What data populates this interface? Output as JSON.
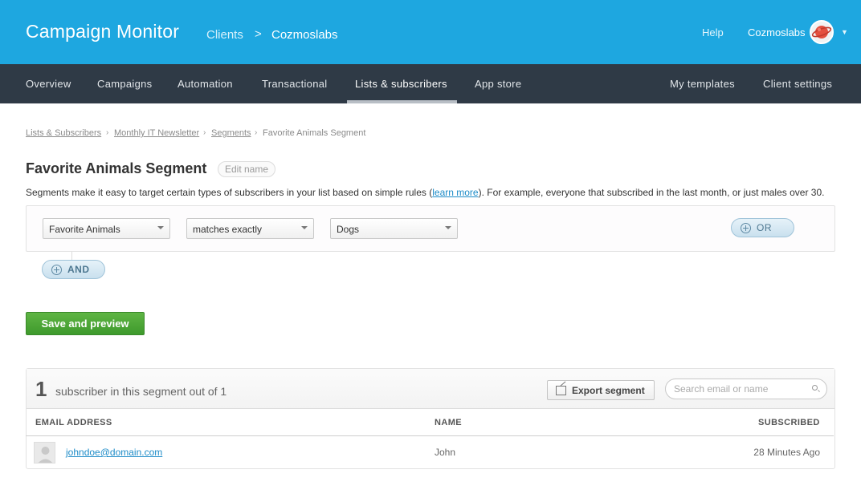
{
  "header": {
    "brand": "Campaign Monitor",
    "breadcrumb_clients": "Clients",
    "breadcrumb_separator": ">",
    "client_name": "Cozmoslabs",
    "help": "Help",
    "user_name": "Cozmoslabs",
    "avatar_icon": "planet-icon",
    "caret_icon": "caret-down-icon",
    "colors": {
      "header_bg": "#1ea7e0",
      "nav_bg": "#2f3a46"
    }
  },
  "nav": {
    "items": [
      {
        "label": "Overview"
      },
      {
        "label": "Campaigns"
      },
      {
        "label": "Automation"
      },
      {
        "label": "Transactional"
      },
      {
        "label": "Lists & subscribers",
        "active": true
      },
      {
        "label": "App store"
      }
    ],
    "right_items": [
      {
        "label": "My templates"
      },
      {
        "label": "Client settings"
      }
    ]
  },
  "breadcrumb": {
    "items": [
      "Lists & Subscribers",
      "Monthly IT Newsletter",
      "Segments",
      "Favorite Animals Segment"
    ],
    "separator": "›"
  },
  "segment": {
    "title": "Favorite Animals Segment",
    "edit_name": "Edit name",
    "description_before": "Segments make it easy to target certain types of subscribers in your list based on simple rules (",
    "description_link": "learn more",
    "description_after": "). For example, everyone that subscribed in the last month, or just males over 30."
  },
  "rule": {
    "field": "Favorite Animals",
    "operator": "matches exactly",
    "value": "Dogs",
    "or_label": "OR",
    "and_label": "AND"
  },
  "actions": {
    "save_preview": "Save and preview",
    "save_color": "#4aa735"
  },
  "results": {
    "count": "1",
    "count_text": "subscriber in this segment out of 1",
    "export_label": "Export segment",
    "search_placeholder": "Search email or name",
    "columns": [
      "EMAIL ADDRESS",
      "NAME",
      "SUBSCRIBED"
    ],
    "rows": [
      {
        "email": "johndoe@domain.com",
        "name": "John",
        "subscribed": "28 Minutes Ago"
      }
    ]
  }
}
